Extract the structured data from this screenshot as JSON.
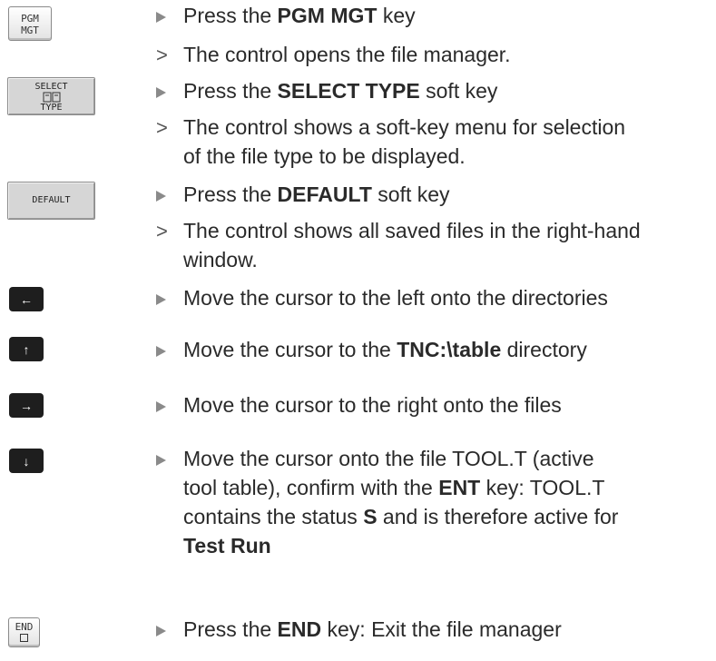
{
  "keys": {
    "pgm_mgt": [
      "PGM",
      "MGT"
    ],
    "select_type": [
      "SELECT",
      "TYPE"
    ],
    "default": "DEFAULT",
    "arrow_left": "←",
    "arrow_up": "↑",
    "arrow_right": "→",
    "arrow_down": "↓",
    "end": "END"
  },
  "steps": {
    "s1_pre": "Press the ",
    "s1_bold": "PGM MGT",
    "s1_post": " key",
    "r1": "The control opens the file manager.",
    "s2_pre": "Press the ",
    "s2_bold": "SELECT TYPE",
    "s2_post": " soft key",
    "r2_l1": "The control shows a soft-key menu for selection",
    "r2_l2": "of the file type to be displayed.",
    "s3_pre": "Press the ",
    "s3_bold": "DEFAULT",
    "s3_post": " soft key",
    "r3_l1": "The control shows all saved files in the right-hand",
    "r3_l2": "window.",
    "s4": "Move the cursor to the left onto the directories",
    "s5_pre": "Move the cursor to the ",
    "s5_bold": "TNC:\\table",
    "s5_post": " directory",
    "s6": "Move the cursor to the right onto the files",
    "s7_l1": "Move the cursor onto the file TOOL.T (active",
    "s7_l2_pre": "tool table), confirm with the ",
    "s7_l2_bold": "ENT",
    "s7_l2_post": " key: TOOL.T",
    "s7_l3_pre": "contains the status ",
    "s7_l3_bold": "S",
    "s7_l3_post": " and is therefore active for",
    "s7_l4_bold": "Test Run",
    "s8_pre": "Press the ",
    "s8_bold": "END",
    "s8_post": " key: Exit the file manager"
  }
}
